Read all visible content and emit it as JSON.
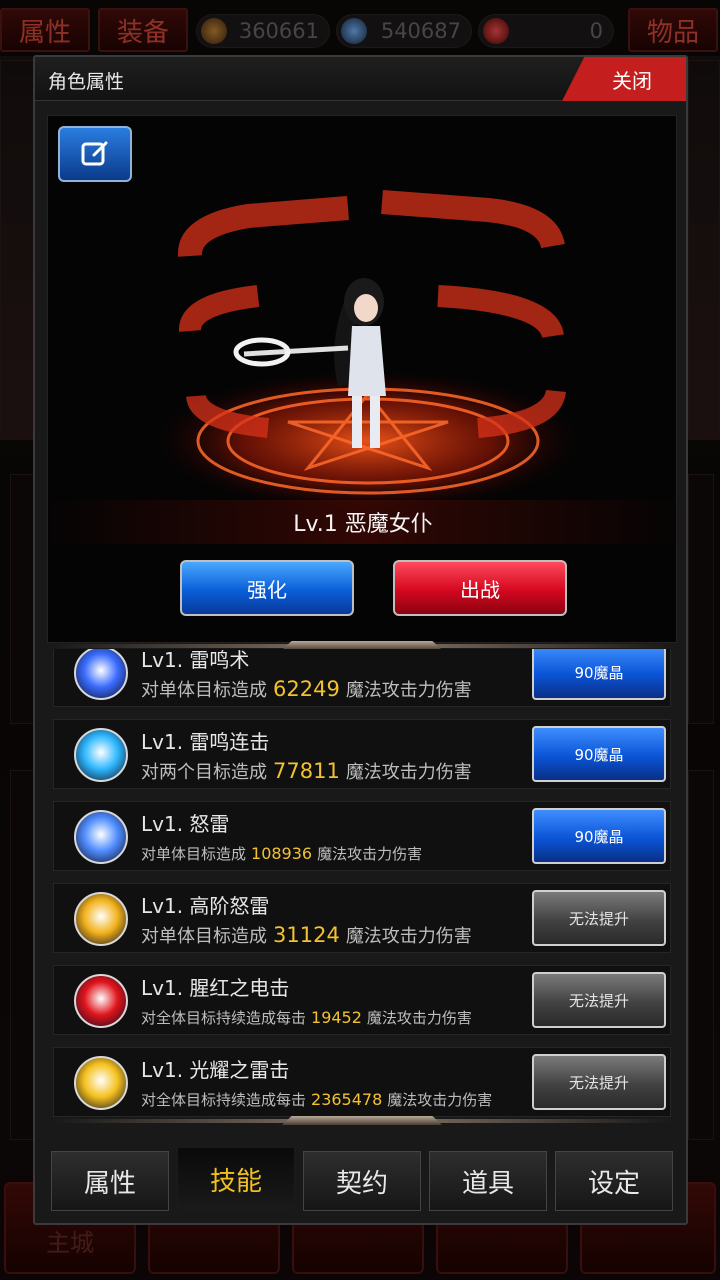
{
  "topbar": {
    "attr_label": "属性",
    "equip_label": "装备",
    "items_label": "物品",
    "resources": [
      {
        "icon": "gold-coin-icon",
        "value": "360661"
      },
      {
        "icon": "blue-crystal-icon",
        "value": "540687"
      },
      {
        "icon": "red-token-icon",
        "value": "0"
      }
    ]
  },
  "bottom_nav": {
    "main_city": "主城"
  },
  "panel": {
    "title": "角色属性",
    "close_label": "关闭",
    "character": {
      "name": "Lv.1 恶魔女仆",
      "enhance_label": "强化",
      "deploy_label": "出战"
    },
    "skills": [
      {
        "name": "Lv1. 雷鸣术",
        "desc_pre": "对单体目标造成",
        "value": "62249",
        "desc_post": "魔法攻击力伤害",
        "button": "90魔晶",
        "button_style": "blue",
        "icon": "lightning-skill-icon",
        "icon_color": "#3a6cff"
      },
      {
        "name": "Lv1. 雷鸣连击",
        "desc_pre": "对两个目标造成",
        "value": "77811",
        "desc_post": "魔法攻击力伤害",
        "button": "90魔晶",
        "button_style": "blue",
        "icon": "lightning-combo-icon",
        "icon_color": "#2fb8ff"
      },
      {
        "name": "Lv1. 怒雷",
        "desc_pre": "对单体目标造成",
        "value": "108936",
        "desc_post": "魔法攻击力伤害",
        "button": "90魔晶",
        "button_style": "blue",
        "icon": "thunder-rage-icon",
        "icon_color": "#4f8dff"
      },
      {
        "name": "Lv1. 高阶怒雷",
        "desc_pre": "对单体目标造成",
        "value": "31124",
        "desc_post": "魔法攻击力伤害",
        "button": "无法提升",
        "button_style": "gray",
        "icon": "advanced-thunder-icon",
        "icon_color": "#f2b21c"
      },
      {
        "name": "Lv1. 腥红之电击",
        "desc_pre": "对全体目标持续造成每击",
        "value": "19452",
        "desc_post": "魔法攻击力伤害",
        "button": "无法提升",
        "button_style": "gray",
        "icon": "crimson-shock-icon",
        "icon_color": "#e0141c"
      },
      {
        "name": "Lv1. 光耀之雷击",
        "desc_pre": "对全体目标持续造成每击",
        "value": "2365478",
        "desc_post": "魔法攻击力伤害",
        "button": "无法提升",
        "button_style": "gray",
        "icon": "radiant-thunder-icon",
        "icon_color": "#f5c11e"
      }
    ],
    "tabs": [
      {
        "label": "属性",
        "active": false
      },
      {
        "label": "技能",
        "active": true
      },
      {
        "label": "契约",
        "active": false
      },
      {
        "label": "道具",
        "active": false
      },
      {
        "label": "设定",
        "active": false
      }
    ]
  },
  "colors": {
    "accent_red": "#c41e1e",
    "value_gold": "#f2c230",
    "active_tab_text": "#f0c020",
    "button_blue": "#0a54d6"
  }
}
